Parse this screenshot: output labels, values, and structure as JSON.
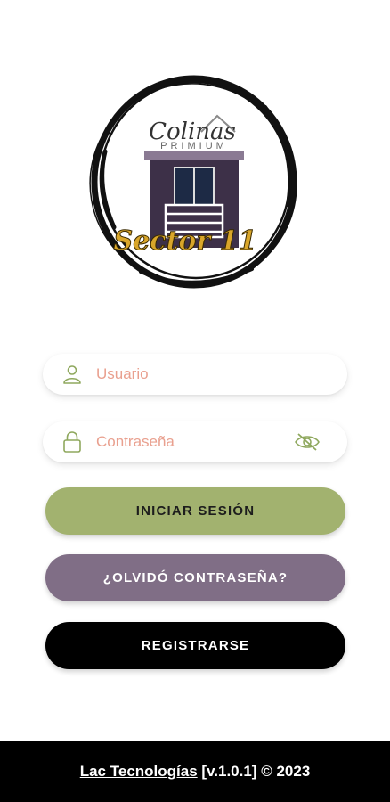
{
  "colors": {
    "primary_button": "#a2b26f",
    "secondary_button": "#806e86",
    "register_button": "#000000",
    "footer_background": "#000000",
    "placeholder": "#e9a08f",
    "icon": "#8fa85e"
  },
  "logo": {
    "name": "colinas-primium-sector-11-logo",
    "line1": "Colinas",
    "line2": "PRIMIUM",
    "line3": "Sector 11"
  },
  "form": {
    "username": {
      "placeholder": "Usuario",
      "value": "",
      "icon": "user-icon"
    },
    "password": {
      "placeholder": "Contraseña",
      "value": "",
      "icon": "lock-icon",
      "toggle_icon": "eye-off-icon"
    }
  },
  "buttons": {
    "login": "INICIAR SESIÓN",
    "forgot": "¿OLVIDÓ CONTRASEÑA?",
    "register": "REGISTRARSE"
  },
  "footer": {
    "company": "Lac Tecnologías",
    "version": "[v.1.0.1]",
    "copyright": "© 2023"
  }
}
